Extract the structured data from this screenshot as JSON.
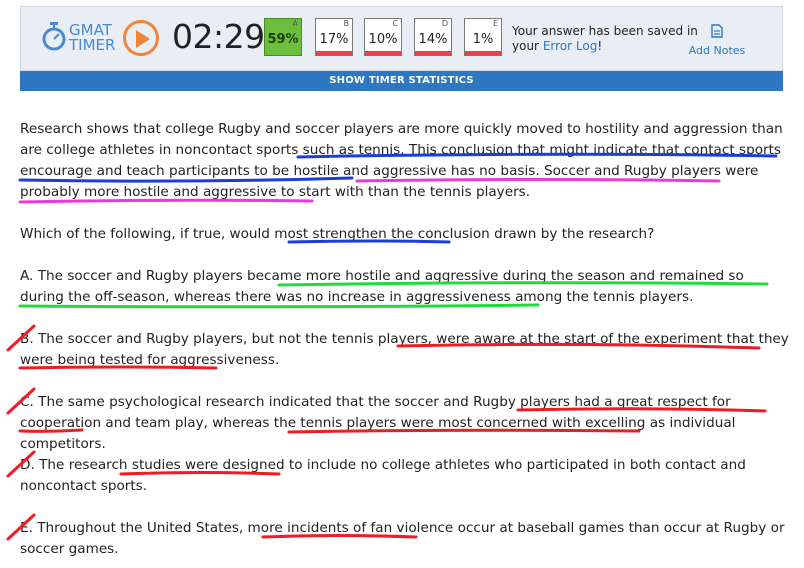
{
  "timer": {
    "logo_line1": "GMAT",
    "logo_line2": "TIMER",
    "time": "02:29",
    "answer_stats": [
      {
        "letter": "A",
        "percent": "59%",
        "correct": true
      },
      {
        "letter": "B",
        "percent": "17%",
        "correct": false
      },
      {
        "letter": "C",
        "percent": "10%",
        "correct": false
      },
      {
        "letter": "D",
        "percent": "14%",
        "correct": false
      },
      {
        "letter": "E",
        "percent": "1%",
        "correct": false
      }
    ],
    "saved_prefix": "Your answer has been saved in",
    "saved_your": "your",
    "saved_link": "Error Log",
    "saved_suffix": "!",
    "add_notes": "Add Notes",
    "show_stats": "SHOW TIMER STATISTICS"
  },
  "passage": {
    "s1": "Research shows that college Rugby and soccer players are more quickly moved to hostility and aggression than are college athletes in noncontact sports such as tennis.",
    "s2": "This conclusion that might indicate that contact sports encourage and teach participants to be hostile and aggressive has no basis.",
    "s3": "Soccer and Rugby players were probably more hostile and aggressive to start with than the tennis players."
  },
  "question": "Which of the following, if true, would most strengthen the conclusion drawn by the research?",
  "options": [
    {
      "letter": "A.",
      "text": "The soccer and Rugby players became more hostile and aggressive during the season and remained so during the off-season, whereas there was no increase in aggressiveness among the tennis players."
    },
    {
      "letter": "B.",
      "text": "The soccer and Rugby players, but not the tennis players, were aware at the start of the experiment that they were being tested for aggressiveness."
    },
    {
      "letter": "C.",
      "text": "The same psychological research indicated that the soccer and Rugby players had a great respect for cooperation and team play, whereas the tennis players were most concerned with excelling as individual competitors."
    },
    {
      "letter": "D.",
      "text": "The research studies were designed to include no college athletes who participated in both contact and noncontact sports."
    },
    {
      "letter": "E.",
      "text": "Throughout the United States, more incidents of fan violence occur at baseball games than occur at Rugby or soccer games."
    }
  ],
  "colors": {
    "accent": "#2d78c0",
    "timer_bg": "#e9eef4",
    "play": "#f0843c",
    "correct": "#6cbf3c",
    "wrong_bar": "#e8424b",
    "pen_blue": "#1a3de0",
    "pen_magenta": "#e83ad8",
    "pen_green": "#1edc3a",
    "pen_red": "#ee1c24"
  },
  "icons": [
    "stopwatch-icon",
    "play-icon",
    "note-icon"
  ]
}
